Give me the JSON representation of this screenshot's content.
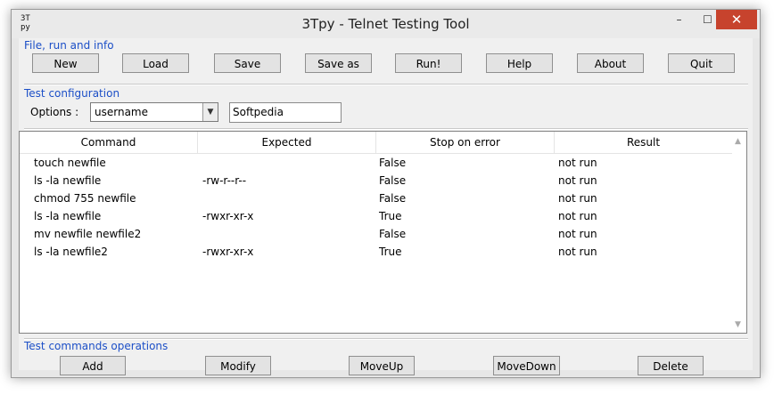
{
  "window": {
    "title": "3Tpy - Telnet Testing Tool",
    "app_icon": "3T\npy",
    "minimize": "–",
    "maximize": "☐",
    "close": "✕"
  },
  "file_group": {
    "label": "File, run and info",
    "buttons": [
      "New",
      "Load",
      "Save",
      "Save as",
      "Run!",
      "Help",
      "About",
      "Quit"
    ]
  },
  "config": {
    "label": "Test configuration",
    "options_label": "Options :",
    "options_value": "username",
    "text_value": "Softpedia"
  },
  "table": {
    "headers": [
      "Command",
      "Expected",
      "Stop on error",
      "Result"
    ],
    "rows": [
      [
        "touch newfile",
        "",
        "False",
        "not run"
      ],
      [
        "ls -la newfile",
        "-rw-r--r--",
        "False",
        "not run"
      ],
      [
        "chmod 755 newfile",
        "",
        "False",
        "not run"
      ],
      [
        "ls -la newfile",
        "-rwxr-xr-x",
        "True",
        "not run"
      ],
      [
        "mv newfile newfile2",
        "",
        "False",
        "not run"
      ],
      [
        "ls -la newfile2",
        "-rwxr-xr-x",
        "True",
        "not run"
      ]
    ]
  },
  "ops_group": {
    "label": "Test commands operations",
    "buttons": [
      "Add",
      "Modify",
      "MoveUp",
      "MoveDown",
      "Delete"
    ]
  },
  "colors": {
    "group_label": "#1c4fc7",
    "close_button": "#c7432d"
  }
}
